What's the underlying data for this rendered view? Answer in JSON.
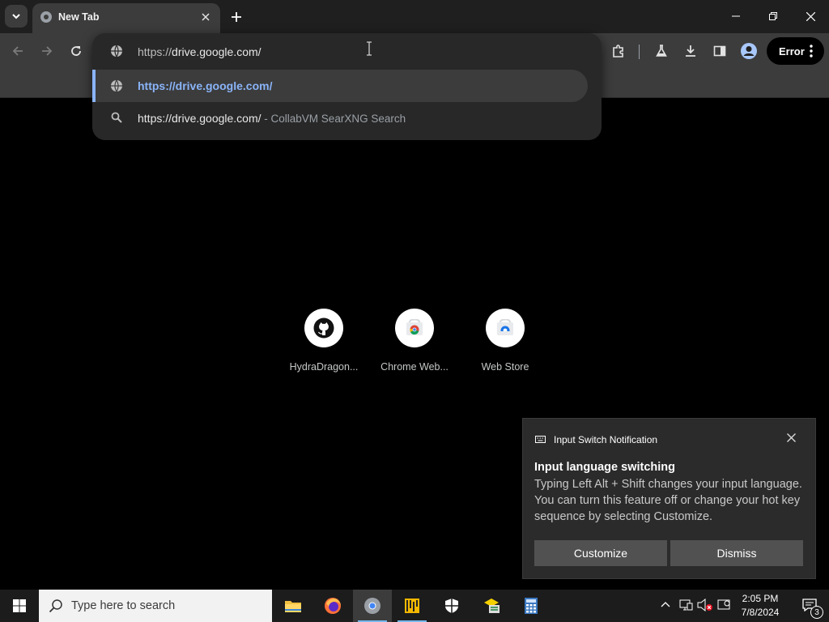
{
  "browser": {
    "tab": {
      "title": "New Tab"
    },
    "error_label": "Error",
    "omnibox": {
      "input_prefix": "https://",
      "input_domain": "drive.google.com/",
      "suggestions": [
        {
          "text": "https://drive.google.com/",
          "icon": "globe-icon"
        },
        {
          "text": "https://drive.google.com/",
          "suffix": " - CollabVM SearXNG Search",
          "icon": "search-icon"
        }
      ]
    }
  },
  "shortcuts": [
    {
      "label": "HydraDragon...",
      "icon": "github-icon"
    },
    {
      "label": "Chrome Web...",
      "icon": "chrome-web-store-icon"
    },
    {
      "label": "Web Store",
      "icon": "web-store-icon"
    }
  ],
  "notification": {
    "app_name": "Input Switch Notification",
    "heading": "Input language switching",
    "body": "Typing Left Alt + Shift changes your input language. You can turn this feature off or change your hot key sequence by selecting Customize.",
    "buttons": {
      "customize": "Customize",
      "dismiss": "Dismiss"
    }
  },
  "taskbar": {
    "search_placeholder": "Type here to search",
    "apps": [
      "file-explorer-icon",
      "firefox-icon",
      "chrome-icon",
      "app-icon",
      "security-icon",
      "network-app-icon",
      "calculator-icon"
    ],
    "time": "2:05 PM",
    "date": "7/8/2024",
    "notification_count": "3"
  },
  "colors": {
    "accent": "#8ab4f8",
    "toolbar": "#3c3c3c",
    "taskbar": "#1c1c1c"
  }
}
